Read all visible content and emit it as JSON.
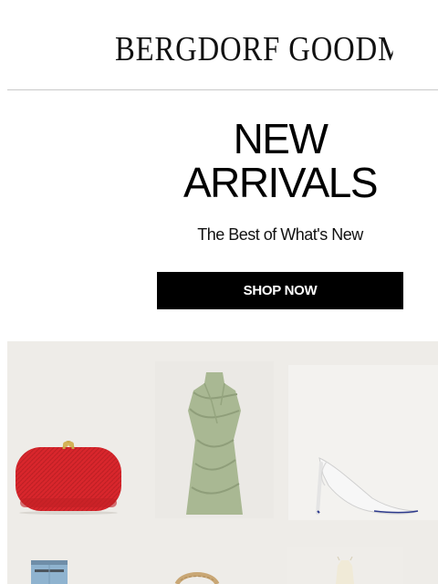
{
  "header": {
    "logo_text": "BERGDORF GOODMAN"
  },
  "hero": {
    "title_line1": "NEW",
    "title_line2": "ARRIVALS",
    "subtitle": "The Best of What's New",
    "cta_label": "SHOP NOW"
  },
  "products": [
    {
      "name": "red-clutch",
      "color": "#d8262c"
    },
    {
      "name": "sage-draped-dress",
      "color": "#a9b893"
    },
    {
      "name": "white-slingback-pump",
      "color": "#f7f7f7"
    },
    {
      "name": "denim-item",
      "color": "#8fb3cf"
    },
    {
      "name": "woven-bag",
      "color": "#c9a775"
    },
    {
      "name": "ivory-top",
      "color": "#f0ead7"
    }
  ]
}
